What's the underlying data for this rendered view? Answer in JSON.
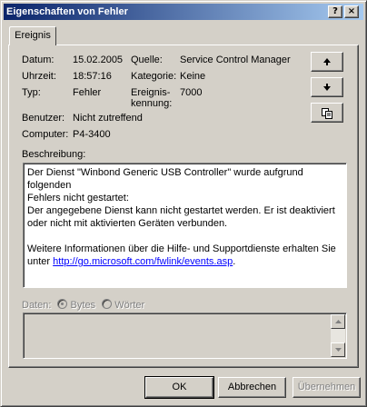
{
  "window": {
    "title": "Eigenschaften von Fehler",
    "help_label": "?",
    "close_label": "×"
  },
  "tab": {
    "label": "Ereignis"
  },
  "fields": {
    "date_label": "Datum:",
    "date_value": "15.02.2005",
    "time_label": "Uhrzeit:",
    "time_value": "18:57:16",
    "type_label": "Typ:",
    "type_value": "Fehler",
    "user_label": "Benutzer:",
    "user_value": "Nicht zutreffend",
    "computer_label": "Computer:",
    "computer_value": "P4-3400",
    "source_label": "Quelle:",
    "source_value": "Service Control Manager",
    "category_label": "Kategorie:",
    "category_value": "Keine",
    "event_id_label_1": "Ereignis-",
    "event_id_label_2": "kennung:",
    "event_id_value": "7000"
  },
  "side_buttons": {
    "up_icon": "arrow-up-icon",
    "down_icon": "arrow-down-icon",
    "copy_icon": "copy-icon"
  },
  "description": {
    "label": "Beschreibung:",
    "line1": "Der Dienst \"Winbond Generic USB Controller\" wurde aufgrund folgenden",
    "line2": "Fehlers nicht gestartet:",
    "line3": "Der angegebene Dienst kann nicht gestartet werden. Er ist deaktiviert",
    "line4": "oder nicht mit aktivierten Geräten verbunden.",
    "line5": "Weitere Informationen über die Hilfe- und Supportdienste erhalten Sie",
    "line6_prefix": "unter",
    "link": "http://go.microsoft.com/fwlink/events.asp",
    "line6_suffix": "."
  },
  "data_section": {
    "label": "Daten:",
    "option_bytes": "Bytes",
    "option_words": "Wörter",
    "selected": "Bytes"
  },
  "buttons": {
    "ok": "OK",
    "cancel": "Abbrechen",
    "apply": "Übernehmen"
  },
  "colors": {
    "face": "#d4d0c8",
    "titlebar_start": "#0a246a",
    "titlebar_end": "#a6caf0",
    "link": "#0000ff"
  }
}
